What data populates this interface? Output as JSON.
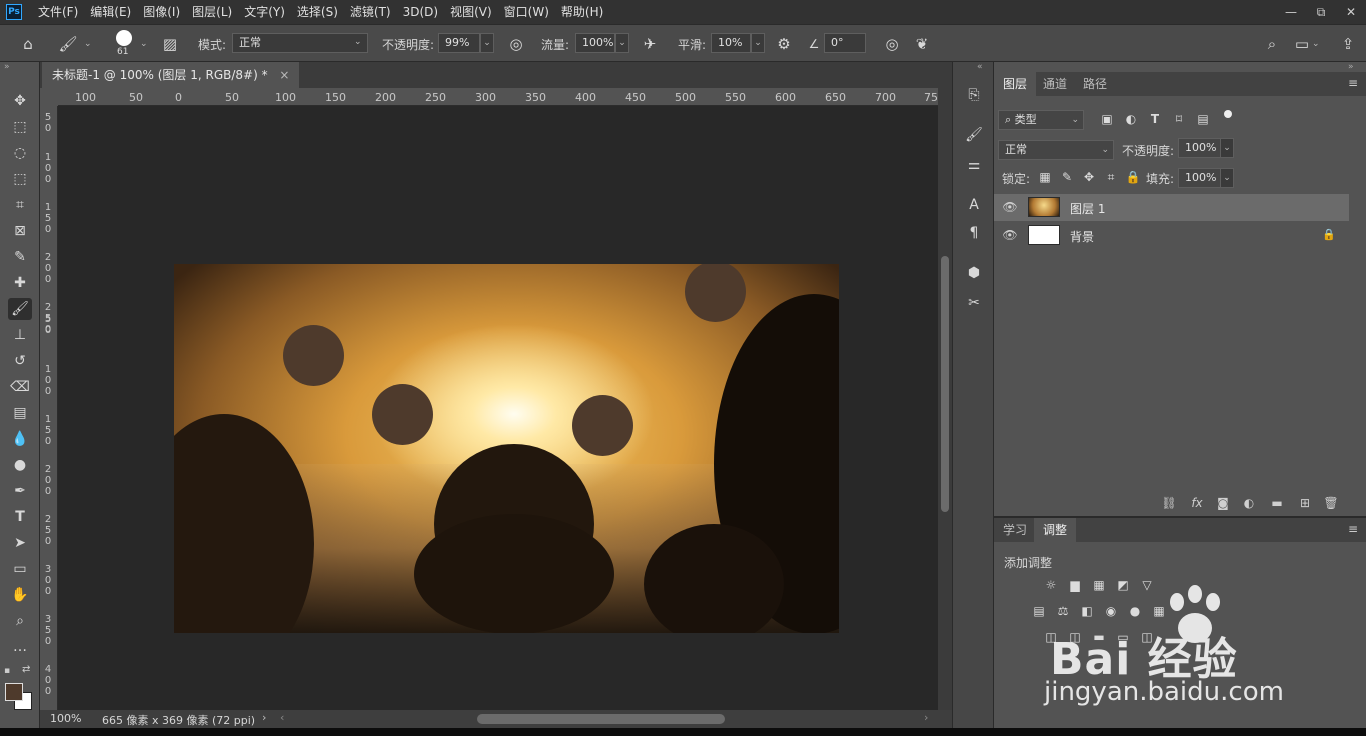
{
  "menubar": {
    "items": [
      "文件(F)",
      "编辑(E)",
      "图像(I)",
      "图层(L)",
      "文字(Y)",
      "选择(S)",
      "滤镜(T)",
      "3D(D)",
      "视图(V)",
      "窗口(W)",
      "帮助(H)"
    ]
  },
  "app_logo": "Ps",
  "window_controls": {
    "minimize": "—",
    "restore": "⧉",
    "close": "✕"
  },
  "options": {
    "brush_size": "61",
    "mode_label": "模式:",
    "mode_value": "正常",
    "opacity_label": "不透明度:",
    "opacity_value": "99%",
    "flow_label": "流量:",
    "flow_value": "100%",
    "smoothing_label": "平滑:",
    "smoothing_value": "10%",
    "angle_value": "0°"
  },
  "document": {
    "tab_title": "未标题-1 @ 100% (图层 1, RGB/8#) *",
    "tab_close": "×",
    "zoom": "100%",
    "doc_info": "665 像素 x 369 像素 (72 ppi)"
  },
  "ruler_top": [
    "100",
    "50",
    "0",
    "50",
    "100",
    "150",
    "200",
    "250",
    "300",
    "350",
    "400",
    "450",
    "500",
    "550",
    "600",
    "650",
    "700",
    "75"
  ],
  "ruler_left": [
    "5\n0",
    "1\n0\n0",
    "1\n5\n0",
    "2\n0\n0",
    "2\n5\n0",
    "0",
    "5\n0",
    "1\n0\n0",
    "1\n5\n0",
    "2\n0\n0",
    "2\n5\n0",
    "3\n0\n0",
    "3\n5\n0",
    "4\n0\n0"
  ],
  "layers_panel": {
    "tabs": [
      "图层",
      "通道",
      "路径"
    ],
    "filter_label": "类型",
    "blend_mode": "正常",
    "opacity_label": "不透明度:",
    "opacity_value": "100%",
    "lock_label": "锁定:",
    "fill_label": "填充:",
    "fill_value": "100%",
    "layers": [
      {
        "name": "图层 1",
        "selected": true
      },
      {
        "name": "背景",
        "selected": false
      }
    ]
  },
  "adjustments_panel": {
    "tabs": [
      "学习",
      "调整"
    ],
    "heading": "添加调整"
  },
  "watermark": {
    "brand": "Bai  经验",
    "url": "jingyan.baidu.com"
  },
  "colors": {
    "foreground": "#4e3a2c",
    "background": "#ffffff",
    "accent_ps": "#31a8ff"
  }
}
